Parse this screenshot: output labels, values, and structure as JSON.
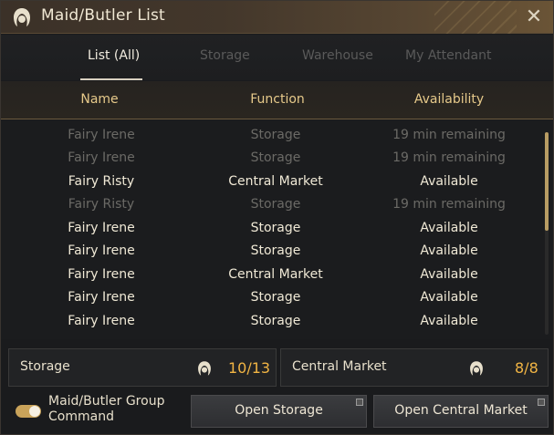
{
  "window": {
    "title": "Maid/Butler List",
    "close_icon": "close-icon",
    "colors": {
      "accent": "#f2b544",
      "header_text": "#e6c98a",
      "title_bar": "#43372b"
    }
  },
  "tabs": [
    {
      "label": "List (All)",
      "active": true
    },
    {
      "label": "Storage",
      "active": false
    },
    {
      "label": "Warehouse",
      "active": false
    },
    {
      "label": "My Attendant",
      "active": false
    }
  ],
  "columns": {
    "name": "Name",
    "function": "Function",
    "availability": "Availability"
  },
  "rows": [
    {
      "name": "Fairy Irene",
      "function": "Storage",
      "availability": "19 min remaining",
      "state": "dim"
    },
    {
      "name": "Fairy Irene",
      "function": "Storage",
      "availability": "19 min remaining",
      "state": "dim"
    },
    {
      "name": "Fairy Risty",
      "function": "Central Market",
      "availability": "Available",
      "state": "lit"
    },
    {
      "name": "Fairy Risty",
      "function": "Storage",
      "availability": "19 min remaining",
      "state": "dim"
    },
    {
      "name": "Fairy Irene",
      "function": "Storage",
      "availability": "Available",
      "state": "lit"
    },
    {
      "name": "Fairy Irene",
      "function": "Storage",
      "availability": "Available",
      "state": "lit"
    },
    {
      "name": "Fairy Irene",
      "function": "Central Market",
      "availability": "Available",
      "state": "lit"
    },
    {
      "name": "Fairy Irene",
      "function": "Storage",
      "availability": "Available",
      "state": "lit"
    },
    {
      "name": "Fairy Irene",
      "function": "Storage",
      "availability": "Available",
      "state": "lit"
    }
  ],
  "counters": {
    "storage": {
      "label": "Storage",
      "value": "10/13",
      "icon": "maid-icon"
    },
    "central_market": {
      "label": "Central Market",
      "value": "8/8",
      "icon": "maid-icon"
    }
  },
  "footer": {
    "toggle_label": "Maid/Butler Group Command",
    "toggle_on": true,
    "open_storage": "Open Storage",
    "open_central_market": "Open Central Market"
  }
}
